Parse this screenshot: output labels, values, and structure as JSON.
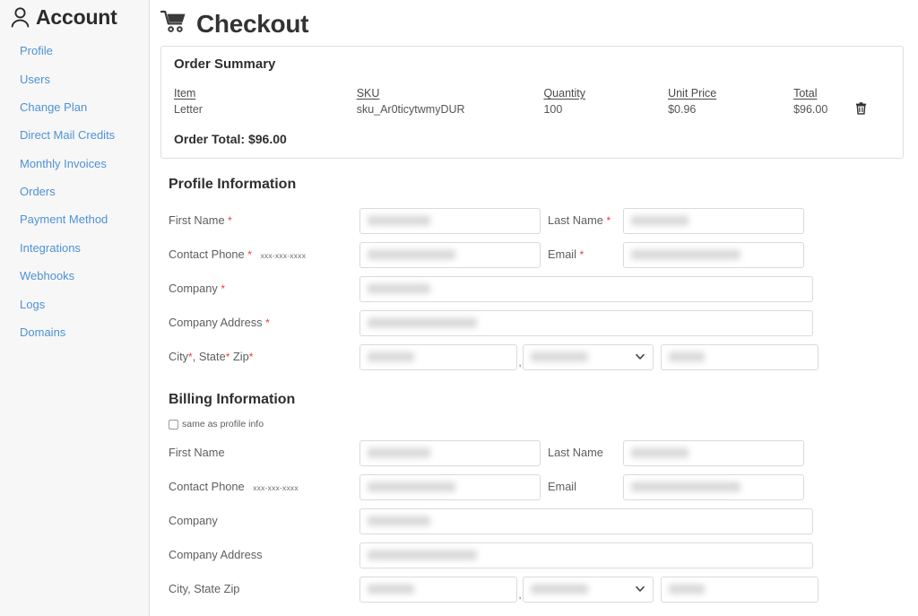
{
  "sidebar": {
    "title": "Account",
    "icon": "user-icon",
    "items": [
      {
        "label": "Profile"
      },
      {
        "label": "Users"
      },
      {
        "label": "Change Plan"
      },
      {
        "label": "Direct Mail Credits"
      },
      {
        "label": "Monthly Invoices"
      },
      {
        "label": "Orders"
      },
      {
        "label": "Payment Method"
      },
      {
        "label": "Integrations"
      },
      {
        "label": "Webhooks"
      },
      {
        "label": "Logs"
      },
      {
        "label": "Domains"
      }
    ],
    "link_color": "#4e92d4",
    "background": "#f7f7f7"
  },
  "header": {
    "title": "Checkout",
    "icon": "shopping-cart-icon"
  },
  "order_summary": {
    "title": "Order Summary",
    "columns": [
      "Item",
      "SKU",
      "Quantity",
      "Unit Price",
      "Total"
    ],
    "rows": [
      {
        "item": "Letter",
        "sku": "sku_Ar0ticytwmyDUR",
        "quantity": "100",
        "unit_price": "$0.96",
        "total": "$96.00",
        "delete_icon": "trash-icon"
      }
    ],
    "order_total_label": "Order Total: $96.00"
  },
  "profile_information": {
    "title": "Profile Information",
    "required_marker": "*",
    "required_color": "#ef3b3b",
    "phone_hint": "xxx-xxx-xxxx",
    "fields": {
      "first_name_label": "First Name",
      "last_name_label": "Last Name",
      "contact_phone_label": "Contact Phone",
      "email_label": "Email",
      "company_label": "Company",
      "company_address_label": "Company Address",
      "city_state_zip_label": "City",
      "city_state_zip_label_state": "State",
      "city_state_zip_label_zip": "Zip",
      "comma": ","
    },
    "values": {
      "first_name": "",
      "last_name": "",
      "contact_phone": "",
      "email": "",
      "company": "",
      "company_address": "",
      "city": "",
      "state": "",
      "zip": ""
    }
  },
  "billing_information": {
    "title": "Billing Information",
    "same_as_profile_label": "same as profile info",
    "same_as_profile_checked": false,
    "phone_hint": "xxx-xxx-xxxx",
    "fields": {
      "first_name_label": "First Name",
      "last_name_label": "Last Name",
      "contact_phone_label": "Contact Phone",
      "email_label": "Email",
      "company_label": "Company",
      "company_address_label": "Company Address",
      "city_state_zip_label": "City, State Zip",
      "comma": ","
    },
    "values": {
      "first_name": "",
      "last_name": "",
      "contact_phone": "",
      "email": "",
      "company": "",
      "company_address": "",
      "city": "",
      "state": "",
      "zip": ""
    }
  }
}
